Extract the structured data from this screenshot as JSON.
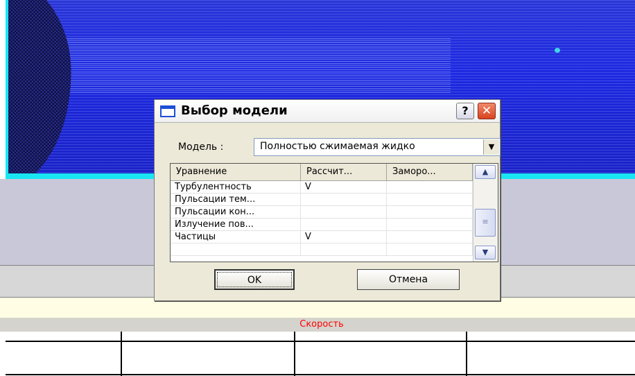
{
  "dialog": {
    "title": "Выбор модели",
    "help_label": "?",
    "close_label": "✕",
    "model_label": "Модель :",
    "model_value": "Полностью сжимаемая жидко",
    "table": {
      "headers": [
        "Уравнение",
        "Рассчит...",
        "Заморо..."
      ],
      "rows": [
        [
          "Турбулентность",
          "V",
          ""
        ],
        [
          "Пульсации тем...",
          "",
          ""
        ],
        [
          "Пульсации кон...",
          "",
          ""
        ],
        [
          "Излучение пов...",
          "",
          ""
        ],
        [
          "Частицы",
          "V",
          ""
        ],
        [
          "",
          "",
          ""
        ]
      ]
    },
    "ok_label": "OK",
    "cancel_label": "Отмена"
  },
  "background": {
    "table_header": "Скорость"
  },
  "colors": {
    "viewport_blue": "#1e29e0",
    "viewport_border": "#19e6f2",
    "header_text": "#ff0000",
    "close_button": "#d8431e"
  },
  "icons": {
    "window_icon": "window-icon",
    "dropdown": "chevron-down-icon",
    "scroll_up": "chevron-up-icon",
    "scroll_down": "chevron-down-icon"
  }
}
